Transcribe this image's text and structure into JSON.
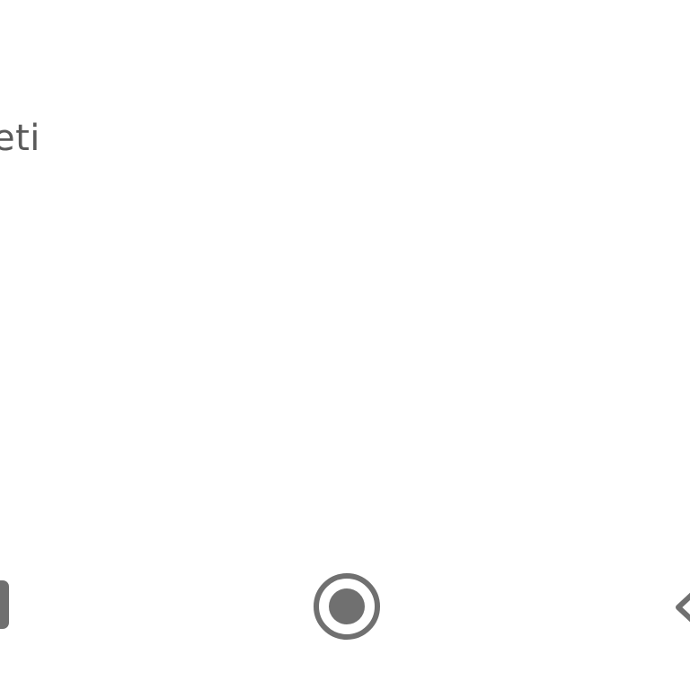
{
  "screen": {
    "visible_text": "eti"
  },
  "navigation": {
    "recents_icon": "recents-icon",
    "home_icon": "home-icon",
    "back_icon": "back-icon"
  },
  "colors": {
    "background": "#ffffff",
    "text": "#5a5a5a",
    "icon": "#707070"
  }
}
